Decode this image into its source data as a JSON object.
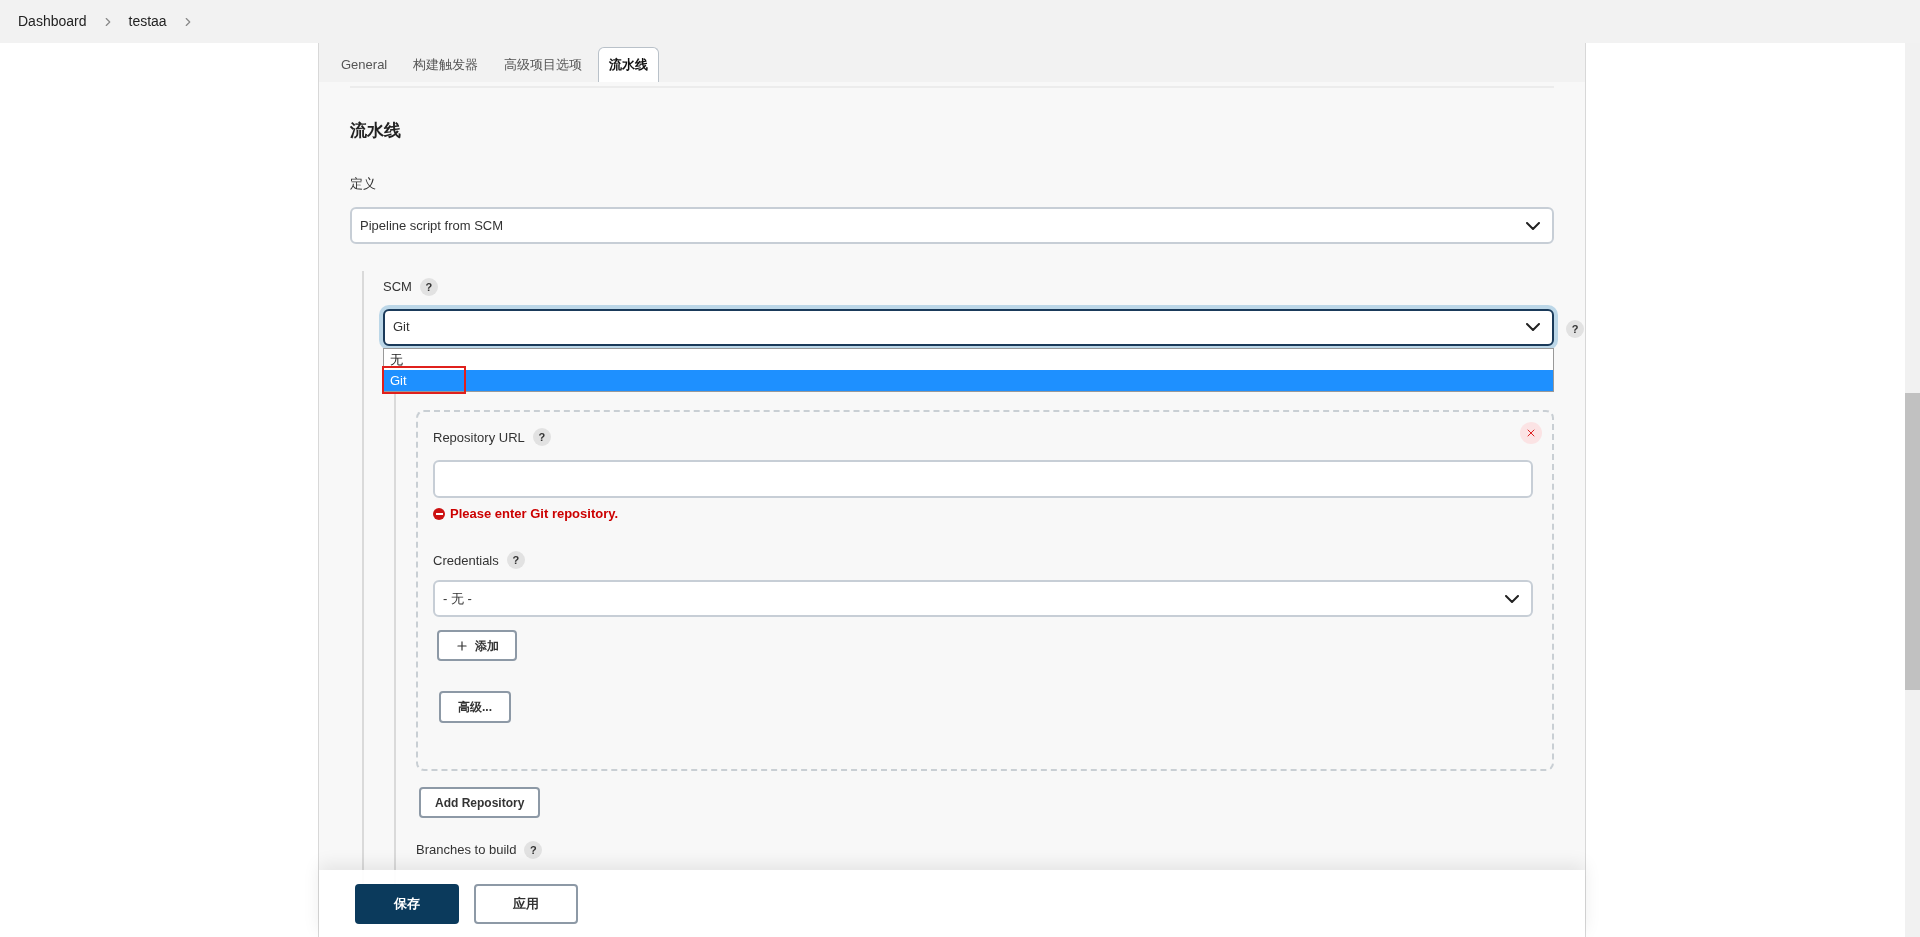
{
  "breadcrumbs": [
    "Dashboard",
    "testaa"
  ],
  "tabs": [
    {
      "label": "General",
      "selected": false
    },
    {
      "label": "构建触发器",
      "selected": false
    },
    {
      "label": "高级项目选项",
      "selected": false
    },
    {
      "label": "流水线",
      "selected": true
    }
  ],
  "section_title": "流水线",
  "definition": {
    "label": "定义",
    "value": "Pipeline script from SCM"
  },
  "scm": {
    "label": "SCM",
    "help": "?",
    "value": "Git",
    "side_help": "?",
    "expanded": true,
    "options": [
      {
        "label": "无",
        "selected": false,
        "highlighted": false
      },
      {
        "label": "Git",
        "selected": true,
        "highlighted": true
      }
    ]
  },
  "repository": {
    "url_label": "Repository URL",
    "url_help": "?",
    "error": "Please enter Git repository.",
    "credentials_label": "Credentials",
    "credentials_help": "?",
    "credentials_value": "- 无 -",
    "add_button": "添加",
    "advanced_button": "高级..."
  },
  "add_repository_button": "Add Repository",
  "branches": {
    "label": "Branches to build",
    "help": "?"
  },
  "footer_buttons": [
    {
      "label": "保存",
      "kind": "primary"
    },
    {
      "label": "应用",
      "kind": "secondary"
    }
  ]
}
